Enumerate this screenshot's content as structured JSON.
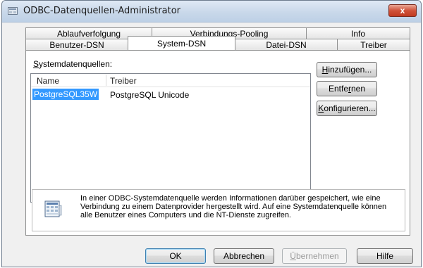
{
  "window": {
    "title": "ODBC-Datenquellen-Administrator",
    "close_label": "x"
  },
  "tabs": {
    "back_row": [
      {
        "label": "Ablaufverfolgung"
      },
      {
        "label": "Verbindungs-Pooling"
      },
      {
        "label": "Info"
      }
    ],
    "front_row": [
      {
        "label": "Benutzer-DSN"
      },
      {
        "label": "System-DSN",
        "active": true
      },
      {
        "label": "Datei-DSN"
      },
      {
        "label": "Treiber"
      }
    ]
  },
  "panel": {
    "group_label_first": "S",
    "group_label_rest": "ystemdatenquellen:",
    "list": {
      "columns": [
        "Name",
        "Treiber"
      ],
      "rows": [
        {
          "name": "PostgreSQL35W",
          "driver": "PostgreSQL Unicode",
          "selected": true
        }
      ]
    },
    "buttons": {
      "add": {
        "u": "H",
        "rest": "inzufügen..."
      },
      "remove": {
        "pre": "Entfe",
        "u": "r",
        "rest": "nen"
      },
      "configure": {
        "u": "K",
        "rest": "onfigurieren..."
      }
    },
    "info": {
      "icon": "database-icon",
      "text": "In einer ODBC-Systemdatenquelle werden Informationen darüber gespeichert, wie eine Verbindung zu einem Datenprovider hergestellt wird. Auf eine Systemdatenquelle können alle Benutzer eines Computers und die NT-Dienste zugreifen."
    }
  },
  "footer": {
    "ok": "OK",
    "cancel": "Abbrechen",
    "apply": {
      "u": "Ü",
      "rest": "bernehmen",
      "disabled": true
    },
    "help": "Hilfe"
  },
  "colors": {
    "selection": "#3399ff",
    "close_button": "#c8452c",
    "titlebar": "#c9d8ea"
  }
}
